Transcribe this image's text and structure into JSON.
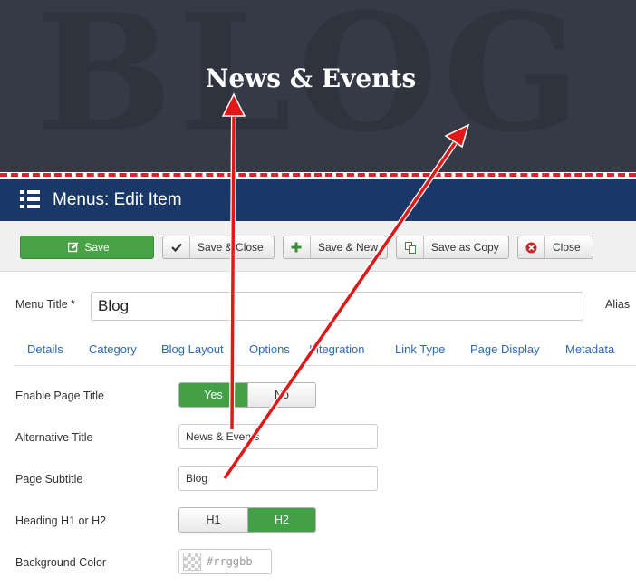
{
  "hero": {
    "watermark": "BLOG",
    "title": "News & Events"
  },
  "header": {
    "title": "Menus: Edit Item",
    "icon": "menu-list-icon"
  },
  "toolbar": {
    "save": "Save",
    "save_close": "Save & Close",
    "save_new": "Save & New",
    "save_copy": "Save as Copy",
    "close": "Close"
  },
  "form": {
    "menu_title_label": "Menu Title *",
    "menu_title_value": "Blog",
    "alias_label": "Alias"
  },
  "tabs": [
    "Details",
    "Category",
    "Blog Layout",
    "Options",
    "Integration",
    "Link Type",
    "Page Display",
    "Metadata"
  ],
  "fields": {
    "enable_page_title": {
      "label": "Enable Page Title",
      "options": [
        "Yes",
        "No"
      ],
      "selected": "Yes"
    },
    "alternative_title": {
      "label": "Alternative Title",
      "value": "News & Events"
    },
    "page_subtitle": {
      "label": "Page Subtitle",
      "value": "Blog"
    },
    "heading": {
      "label": "Heading H1 or H2",
      "options": [
        "H1",
        "H2"
      ],
      "selected": "H2"
    },
    "background_color": {
      "label": "Background Color",
      "placeholder": "#rrggbb"
    }
  },
  "colors": {
    "header": "#1a3867",
    "save_green": "#4aa246",
    "active_green": "#43a047",
    "arrow_red": "#e01818",
    "hero_bg": "#363a46"
  }
}
